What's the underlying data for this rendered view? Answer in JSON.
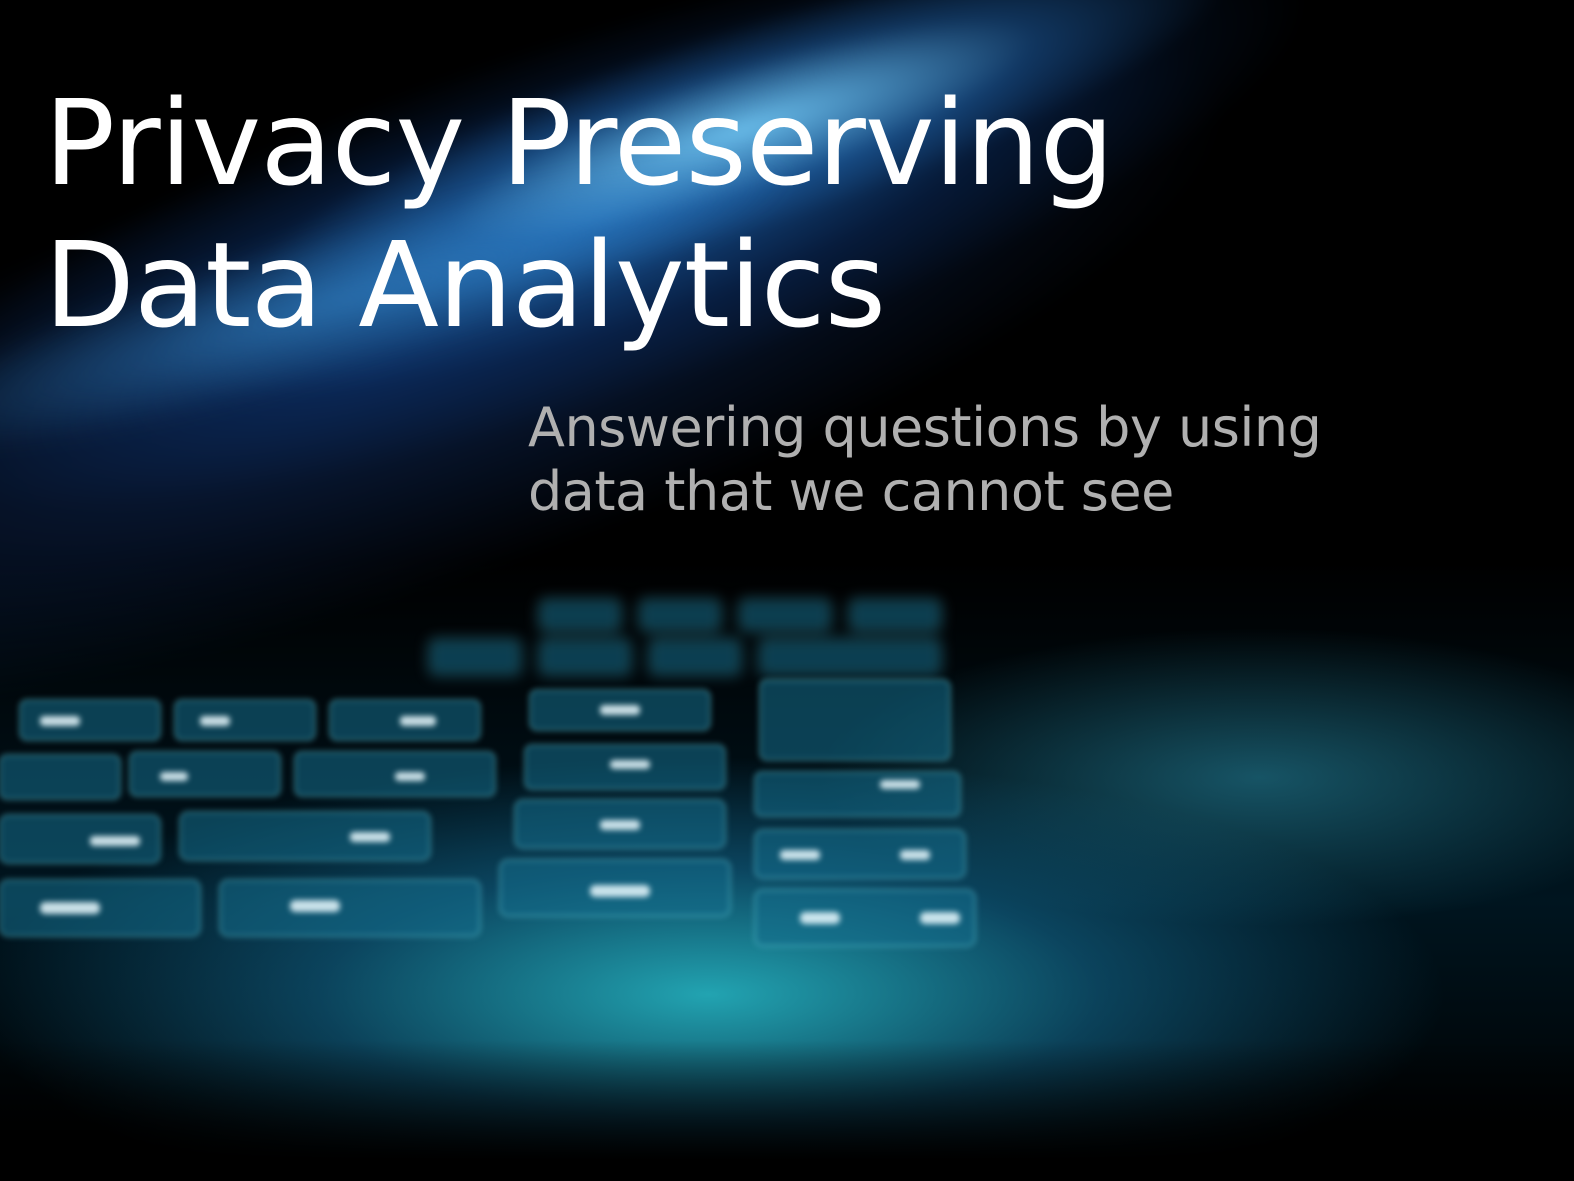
{
  "slide": {
    "title_lines": [
      "Privacy Preserving",
      "Data Analytics"
    ],
    "subtitle_lines": [
      "Answering questions by using",
      "data that we cannot see"
    ],
    "background": {
      "image": "blurred laptop keyboard under blue-cyan light",
      "colors": {
        "base": "#000000",
        "streak": "#1e6ebe",
        "glow": "#28bec8"
      }
    },
    "colors": {
      "title": "#ffffff",
      "subtitle": "#b0b0b0"
    }
  }
}
